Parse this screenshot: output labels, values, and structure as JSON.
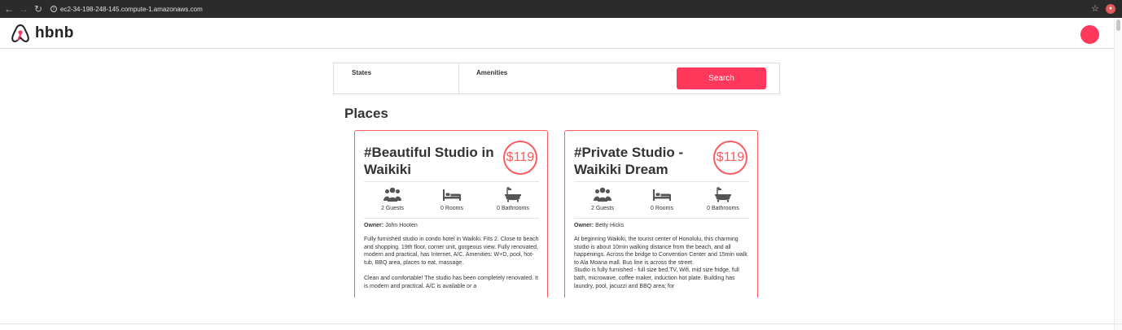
{
  "browser": {
    "url": "ec2-34-198-248-145.compute-1.amazonaws.com",
    "back_icon": "back-arrow-icon",
    "forward_icon": "forward-arrow-icon",
    "reload_icon": "reload-icon",
    "info_icon": "info-icon",
    "star_icon": "star-icon",
    "extension_icon": "extension-icon"
  },
  "header": {
    "logo_text": "hbnb",
    "accent_color": "#ff385c"
  },
  "filters": {
    "states_title": "States",
    "amenities_title": "Amenities",
    "search_label": "Search"
  },
  "places_title": "Places",
  "places": [
    {
      "name": "#Beautiful Studio in Waikiki",
      "price": "$119",
      "guests": "2 Guests",
      "rooms": "0 Rooms",
      "bathrooms": "0 Bathrooms",
      "owner_label": "Owner:",
      "owner": "John Hooten",
      "description": [
        "Fully furnished studio in condo hotel in Waikiki. Fits 2. Close to beach and shopping. 19th floor, corner unit, gorgeous view. Fully renovated, modern and practical, has Internet, A/C. Amenities: W+D, pool, hot-tub, BBQ area, places to eat, massage.",
        "Clean and comfortable! The studio has been completely renovated. It is modern and practical. A/C is available or a"
      ]
    },
    {
      "name": "#Private Studio - Waikiki Dream",
      "price": "$119",
      "guests": "2 Guests",
      "rooms": "0 Rooms",
      "bathrooms": "0 Bathrooms",
      "owner_label": "Owner:",
      "owner": "Betty Hicks",
      "description": [
        "At beginning Waikiki, the tourist center of Honolulu, this charming studio is about 10min walking distance from the beach, and all happenings. Across the bridge to Convention Center and 15min walk to Ala Moana mall. Bus line is across the street.",
        "Studio is fully furnished - full size bed,TV, Wifi, mid size fridge, full bath, microwave, coffee maker, induction hot plate. Building has laundry, pool, jacuzzi and BBQ area; for"
      ]
    }
  ]
}
